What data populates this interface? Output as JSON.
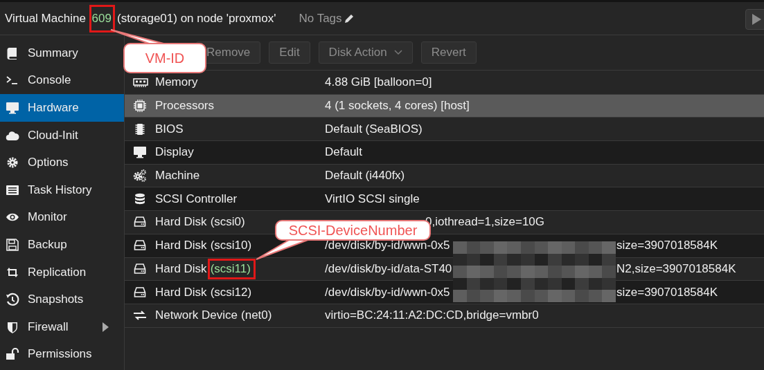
{
  "header": {
    "title_prefix": "Virtual Machine",
    "vmid": "609",
    "vmid_highlighted": true,
    "title_suffix": "(storage01) on node 'proxmox'",
    "tags": "No Tags"
  },
  "sidebar": {
    "items": [
      {
        "label": "Summary",
        "selected": false,
        "submenu": false
      },
      {
        "label": "Console",
        "selected": false,
        "submenu": false
      },
      {
        "label": "Hardware",
        "selected": true,
        "submenu": false
      },
      {
        "label": "Cloud-Init",
        "selected": false,
        "submenu": false
      },
      {
        "label": "Options",
        "selected": false,
        "submenu": false
      },
      {
        "label": "Task History",
        "selected": false,
        "submenu": false
      },
      {
        "label": "Monitor",
        "selected": false,
        "submenu": false
      },
      {
        "label": "Backup",
        "selected": false,
        "submenu": false
      },
      {
        "label": "Replication",
        "selected": false,
        "submenu": false
      },
      {
        "label": "Snapshots",
        "selected": false,
        "submenu": false
      },
      {
        "label": "Firewall",
        "selected": false,
        "submenu": true
      },
      {
        "label": "Permissions",
        "selected": false,
        "submenu": false
      }
    ]
  },
  "toolbar": {
    "buttons": [
      {
        "label": "Remove",
        "disabled": true,
        "dropdown": false
      },
      {
        "label": "Edit",
        "disabled": true,
        "dropdown": false
      },
      {
        "label": "Disk Action",
        "disabled": true,
        "dropdown": true
      },
      {
        "label": "Revert",
        "disabled": true,
        "dropdown": false
      }
    ]
  },
  "hardware": {
    "rows": [
      {
        "name": "Memory",
        "value": "4.88 GiB [balloon=0]",
        "selected": false
      },
      {
        "name": "Processors",
        "value": "4 (1 sockets, 4 cores) [host]",
        "selected": true
      },
      {
        "name": "BIOS",
        "value": "Default (SeaBIOS)",
        "selected": false
      },
      {
        "name": "Display",
        "value": "Default",
        "selected": false
      },
      {
        "name": "Machine",
        "value": "Default (i440fx)",
        "selected": false
      },
      {
        "name": "SCSI Controller",
        "value": "VirtIO SCSI single",
        "selected": false
      },
      {
        "name": "Hard Disk",
        "device": "(scsi0)",
        "device_highlighted": false,
        "value": "0,iothread=1,size=10G",
        "selected": false
      },
      {
        "name": "Hard Disk",
        "device": "(scsi10)",
        "device_highlighted": false,
        "value": "/dev/disk/by-id/wwn-0x5",
        "value_end": "size=3907018584K",
        "selected": false
      },
      {
        "name": "Hard Disk",
        "device": "(scsi11)",
        "device_highlighted": true,
        "value": "/dev/disk/by-id/ata-ST40",
        "value_end": "N2,size=3907018584K",
        "selected": false
      },
      {
        "name": "Hard Disk",
        "device": "(scsi12)",
        "device_highlighted": false,
        "value": "/dev/disk/by-id/wwn-0x5",
        "value_end": "size=3907018584K",
        "selected": false
      },
      {
        "name": "Network Device",
        "device": "(net0)",
        "device_highlighted": false,
        "value": "virtio=BC:24:11:A2:DC:CD,bridge=vmbr0",
        "selected": false
      }
    ]
  },
  "annotations": [
    {
      "text": "VM-ID"
    },
    {
      "text": "SCSI-DeviceNumber"
    }
  ]
}
